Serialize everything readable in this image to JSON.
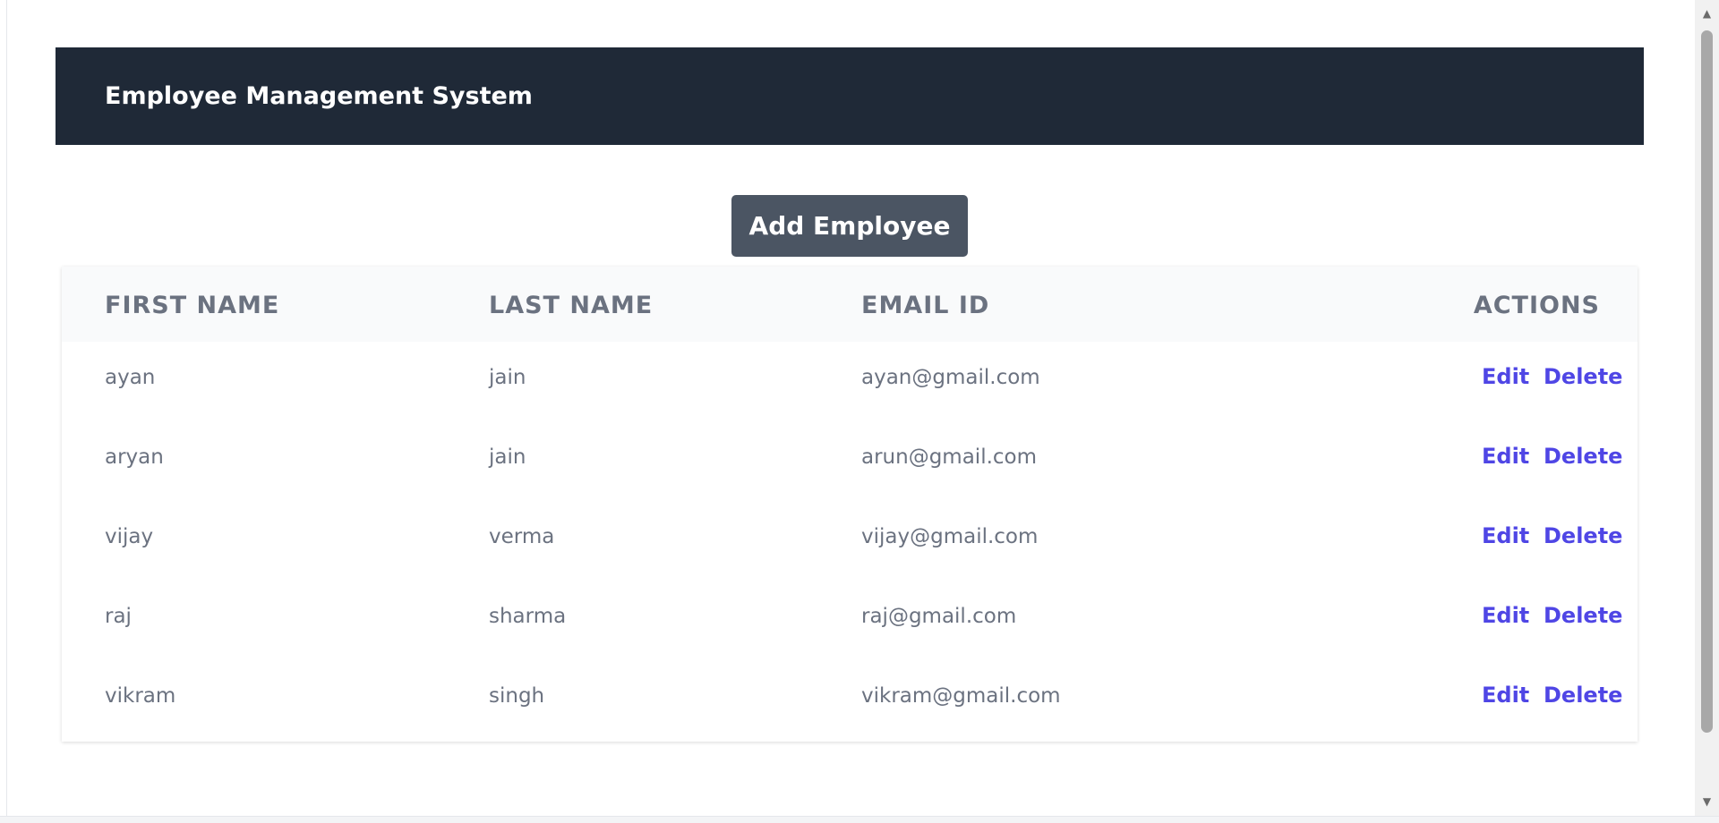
{
  "header": {
    "title": "Employee Management System"
  },
  "toolbar": {
    "add_label": "Add Employee"
  },
  "table": {
    "columns": [
      "FIRST NAME",
      "LAST NAME",
      "EMAIL ID",
      "ACTIONS"
    ],
    "rows": [
      {
        "first": "ayan",
        "last": "jain",
        "email": "ayan@gmail.com",
        "edit": "Edit",
        "delete": "Delete"
      },
      {
        "first": "aryan",
        "last": "jain",
        "email": "arun@gmail.com",
        "edit": "Edit",
        "delete": "Delete"
      },
      {
        "first": "vijay",
        "last": "verma",
        "email": "vijay@gmail.com",
        "edit": "Edit",
        "delete": "Delete"
      },
      {
        "first": "raj",
        "last": "sharma",
        "email": "raj@gmail.com",
        "edit": "Edit",
        "delete": "Delete"
      },
      {
        "first": "vikram",
        "last": "singh",
        "email": "vikram@gmail.com",
        "edit": "Edit",
        "delete": "Delete"
      }
    ]
  },
  "colors": {
    "header_bg": "#1f2937",
    "button_bg": "#4b5563",
    "action_link": "#4f46e5",
    "text_muted": "#6b7280"
  },
  "scrollbar": {
    "up_icon": "arrow-up-icon",
    "down_icon": "arrow-down-icon"
  }
}
